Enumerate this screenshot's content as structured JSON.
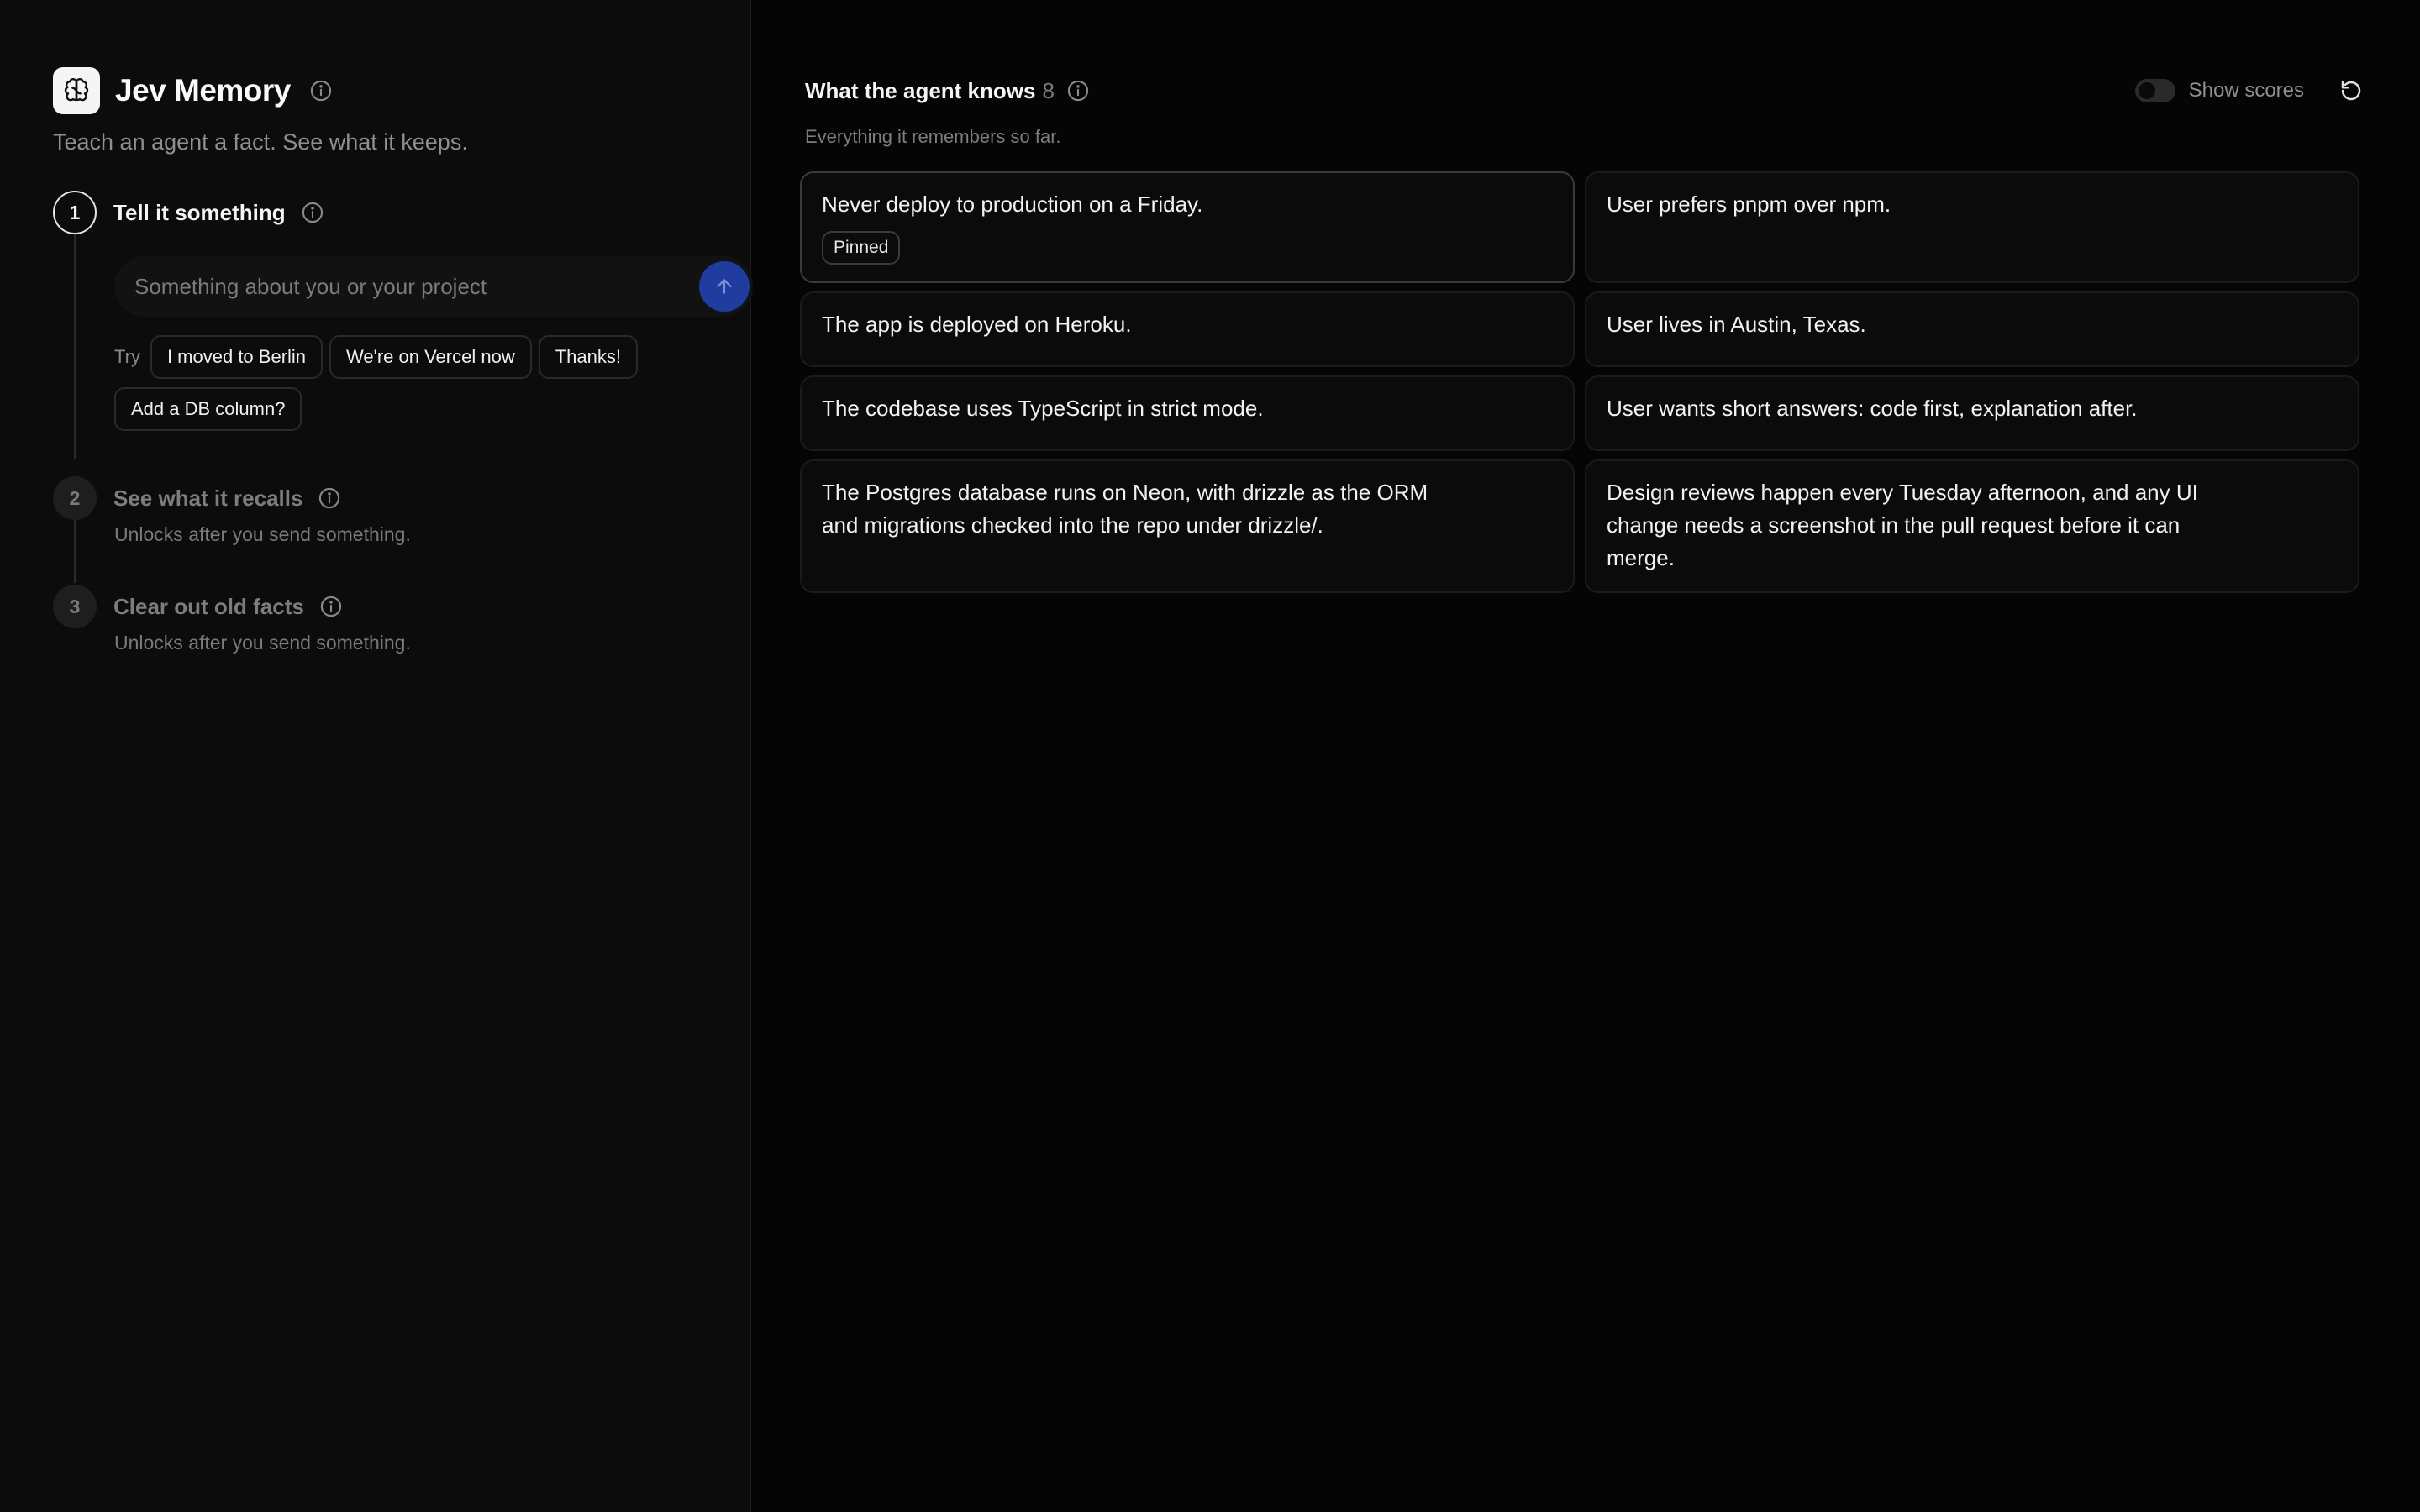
{
  "brand": {
    "title": "Jev Memory",
    "tagline": "Teach an agent a fact. See what it keeps."
  },
  "steps": [
    {
      "number": "1",
      "title": "Tell it something",
      "state": "active"
    },
    {
      "number": "2",
      "title": "See what it recalls",
      "state": "locked",
      "note": "Unlocks after you send something."
    },
    {
      "number": "3",
      "title": "Clear out old facts",
      "state": "locked",
      "note": "Unlocks after you send something."
    }
  ],
  "composer": {
    "placeholder": "Something about you or your project",
    "value": ""
  },
  "suggestions": {
    "label": "Try",
    "chips": [
      "I moved to Berlin",
      "We're on Vercel now",
      "Thanks!",
      "Add a DB column?"
    ]
  },
  "memory": {
    "title": "What the agent knows",
    "count": "8",
    "subtitle": "Everything it remembers so far.",
    "show_scores_label": "Show scores",
    "show_scores": false,
    "pinned_label": "Pinned",
    "items": [
      {
        "text": "Never deploy to production on a Friday.",
        "pinned": true
      },
      {
        "text": "User prefers pnpm over npm.",
        "pinned": false
      },
      {
        "text": "The app is deployed on Heroku.",
        "pinned": false
      },
      {
        "text": "User lives in Austin, Texas.",
        "pinned": false
      },
      {
        "text": "The codebase uses TypeScript in strict mode.",
        "pinned": false
      },
      {
        "text": "User wants short answers: code first, explanation after.",
        "pinned": false
      },
      {
        "text": "The Postgres database runs on Neon, with drizzle as the ORM and migrations checked into the repo under drizzle/.",
        "pinned": false
      },
      {
        "text": "Design reviews happen every Tuesday afternoon, and any UI change needs a screenshot in the pull request before it can merge.",
        "pinned": false
      }
    ]
  },
  "colors": {
    "accent": "#1f3c9e",
    "sidebar_bg": "#0c0c0c",
    "main_bg": "#050505"
  },
  "icons": {
    "logo": "brain-icon",
    "info": "info-icon",
    "send": "arrow-up-icon",
    "refresh": "refresh-icon"
  }
}
